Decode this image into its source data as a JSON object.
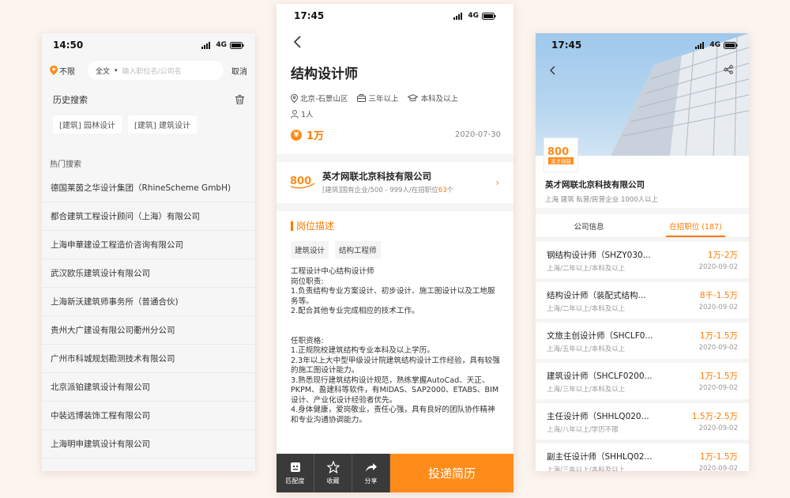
{
  "search_screen": {
    "time": "14:50",
    "network": "4G",
    "location": "不限",
    "search_mode": "全文",
    "search_placeholder": "输入职位名/公司名",
    "cancel_label": "取消",
    "history_title": "历史搜索",
    "history": [
      "[建筑] 园林设计",
      "[建筑] 建筑设计"
    ],
    "hot_title": "热门搜索",
    "hot": [
      "德国莱茵之华设计集团（RhineScheme GmbH)",
      "都合建筑工程设计顾问（上海）有限公司",
      "上海申華建设工程造价咨询有限公司",
      "武汉欧乐建筑设计有限公司",
      "上海新沃建筑师事务所（普通合伙)",
      "贵州大广建设有限公司衢州分公司",
      "广州市科城规划勘测技术有限公司",
      "北京派铂建筑设计有限公司",
      "中装远博装饰工程有限公司",
      "上海明申建筑设计有限公司"
    ]
  },
  "job_screen": {
    "time": "17:45",
    "network": "4G",
    "title": "结构设计师",
    "location": "北京-石景山区",
    "experience": "三年以上",
    "education": "本科及以上",
    "headcount": "1人",
    "salary": "1万",
    "salary_icon": "¥",
    "date": "2020-07-30",
    "company_name": "英才网联北京科技有限公司",
    "company_info": "[建筑]国有企业/500 - 999人/在招职位",
    "company_jobs": "63",
    "company_jobs_suffix": "个",
    "section_title": "岗位描述",
    "tags": [
      "建筑设计",
      "结构工程师"
    ],
    "description": "工程设计中心结构设计师\n岗位职责:\n1.负责结构专业方案设计、初步设计、施工图设计以及工地服务等。\n2.配合其他专业完成相应的技术工作。\n\n\n任职资格:\n1.正规院校建筑结构专业本科及以上学历。\n2.3年以上大中型甲级设计院建筑结构设计工作经验，具有较强的施工图设计能力。\n3.熟悉现行建筑结构设计规范，熟练掌握AutoCad、天正、PKPM、盈建科等软件，有MIDAS、SAP2000、ETABS、BIM设计、产业化设计经验者优先。\n4.身体健康，爱岗敬业，责任心强，具有良好的团队协作精神和专业沟通协调能力。",
    "bottom": {
      "match": "匹配度",
      "favorite": "收藏",
      "share": "分享",
      "apply": "投递简历"
    }
  },
  "company_screen": {
    "time": "17:45",
    "network": "4G",
    "logo_text": "英才网联",
    "company_name": "英才网联北京科技有限公司",
    "company_info": "上海 建筑 私营/民营企业 1000人以上",
    "tabs": [
      "公司信息",
      "在招职位 (187)"
    ],
    "jobs": [
      {
        "title": "钢结构设计师（SHZY030...",
        "salary": "1万-2万",
        "meta": "上海/二年以上/本科及以上",
        "date": "2020-09-02"
      },
      {
        "title": "结构设计师（装配式结构...",
        "salary": "8千-1.5万",
        "meta": "上海/二年以上/本科及以上",
        "date": "2020-09-02"
      },
      {
        "title": "文旅主创设计师（SHCLF0...",
        "salary": "1万-1.5万",
        "meta": "上海/五年以上/本科及以上",
        "date": "2020-09-02"
      },
      {
        "title": "建筑设计师（SHCLF0200...",
        "salary": "1万-1.5万",
        "meta": "上海/三年以上/本科及以上",
        "date": "2020-09-02"
      },
      {
        "title": "主任设计师（SHHLQ020...",
        "salary": "1.5万-2.5万",
        "meta": "上海/八年以上/学历不限",
        "date": "2020-09-02"
      },
      {
        "title": "副主任设计师（SHHLQ02...",
        "salary": "1万-1.5万",
        "meta": "上海/三年以上/本科及以上",
        "date": "2020-09-02"
      }
    ]
  },
  "colors": {
    "accent": "#ff7a00",
    "bottom_bar": "#3a3a3a",
    "background": "#fcf4ef"
  },
  "icons": [
    "location-pin-icon",
    "trash-icon",
    "back-arrow-icon",
    "briefcase-icon",
    "graduation-cap-icon",
    "person-icon",
    "share-icon",
    "star-icon",
    "robot-icon"
  ]
}
